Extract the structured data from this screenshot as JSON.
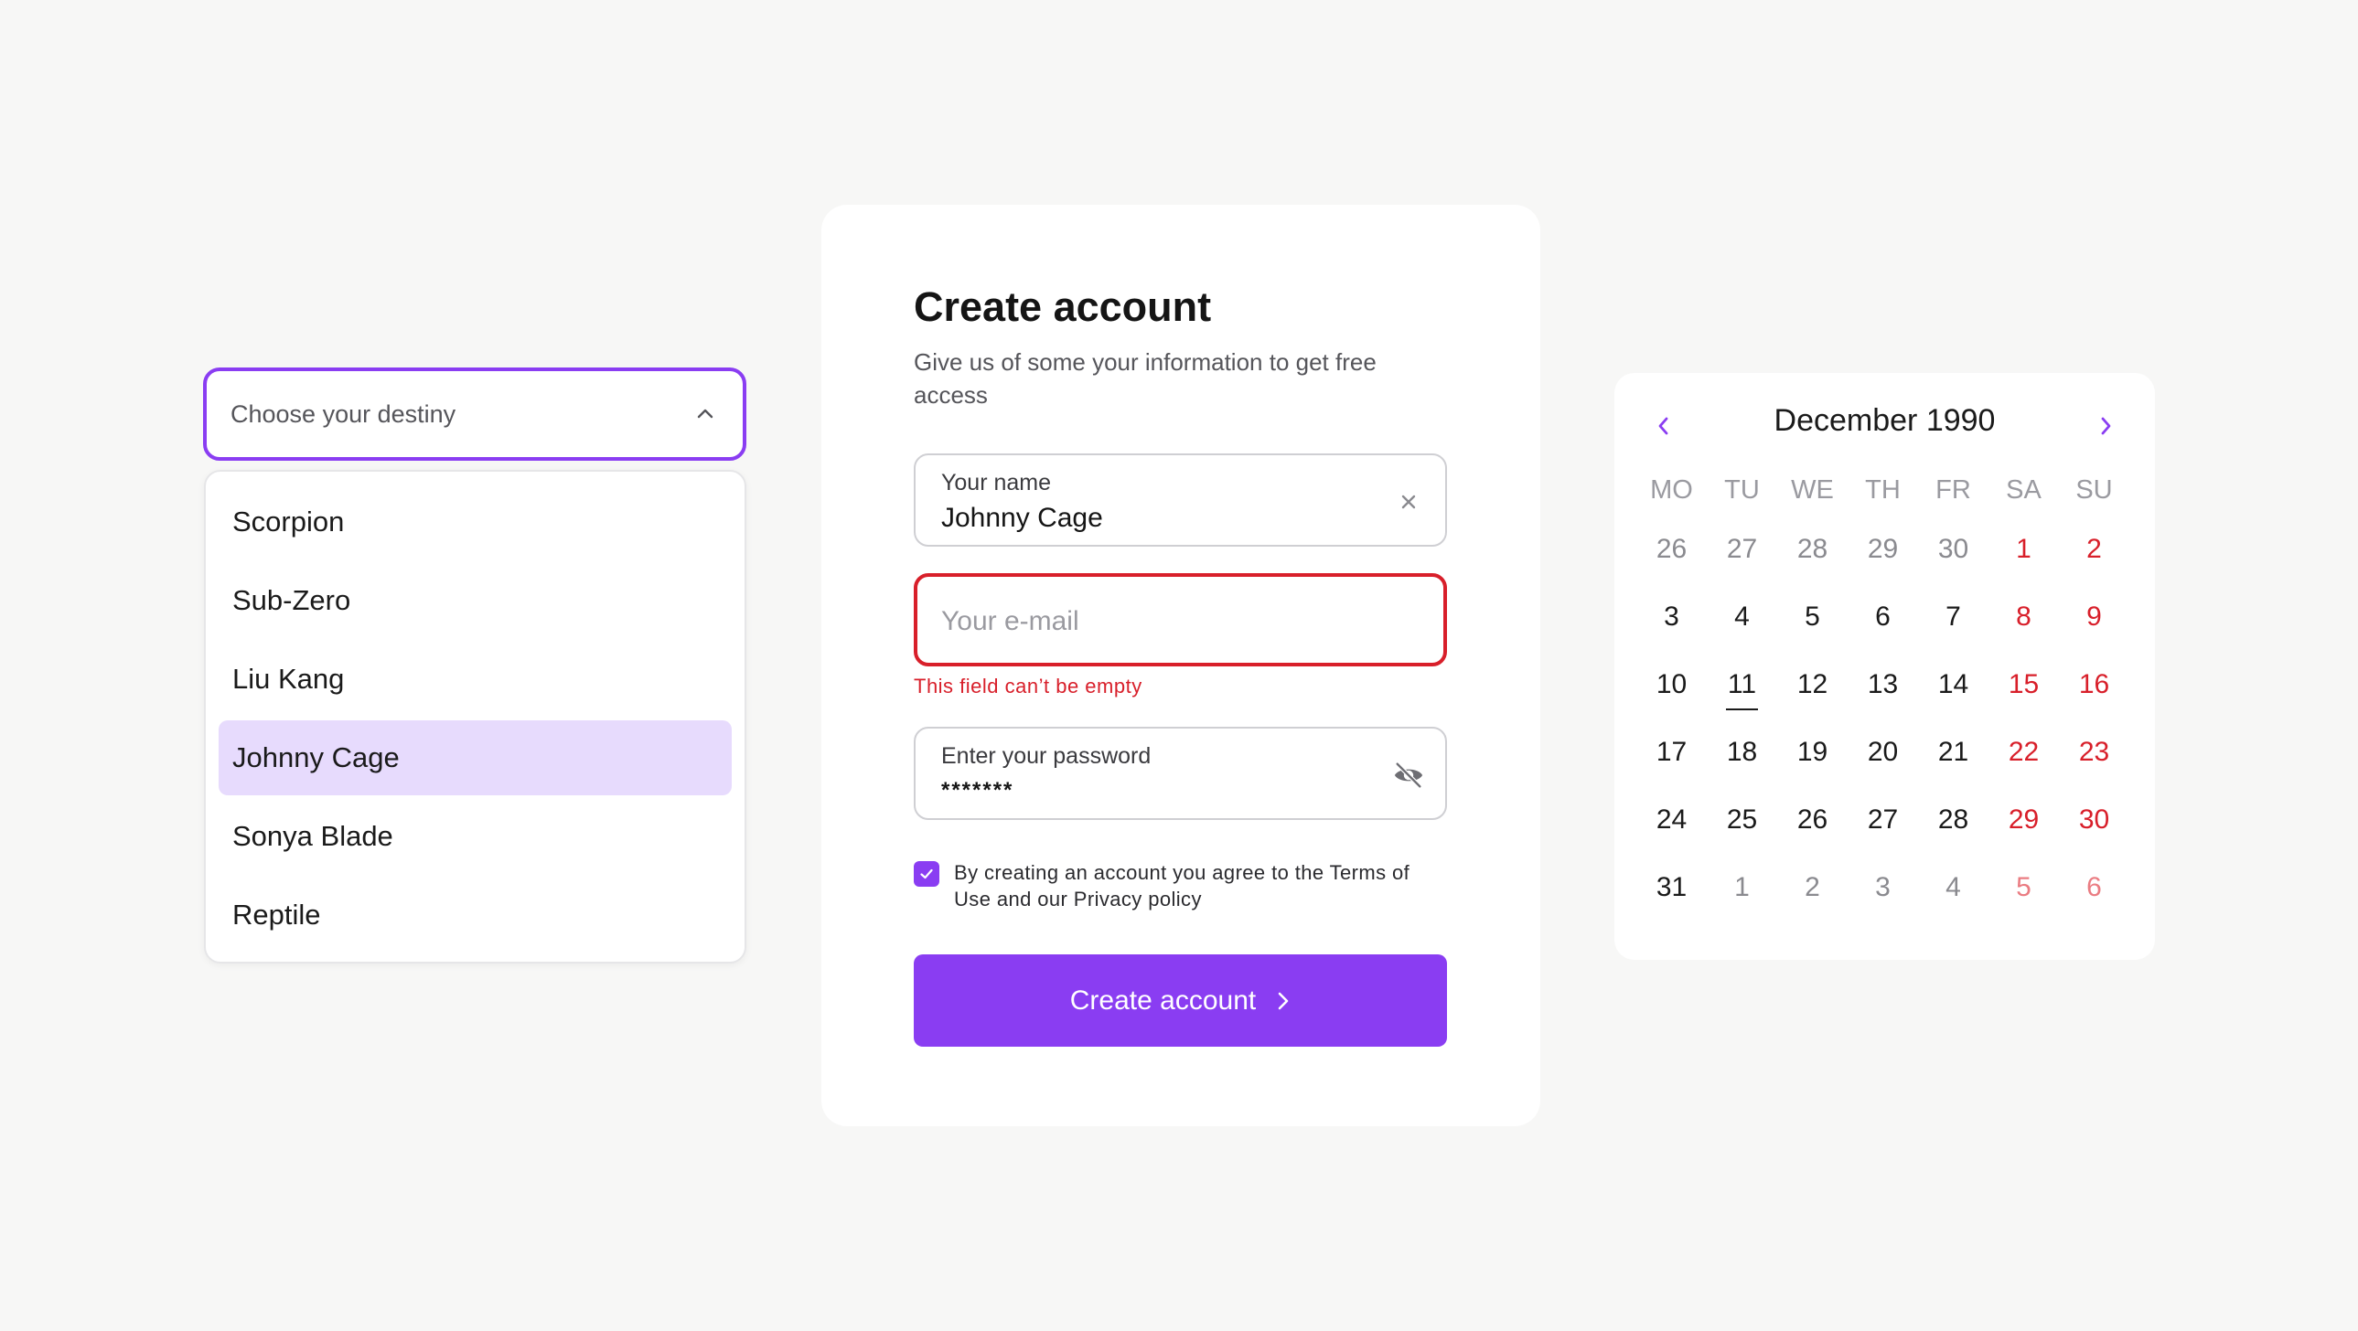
{
  "dropdown": {
    "placeholder": "Choose your destiny",
    "open": true,
    "selected": "Johnny Cage",
    "options": [
      "Scorpion",
      "Sub-Zero",
      "Liu Kang",
      "Johnny Cage",
      "Sonya Blade",
      "Reptile"
    ]
  },
  "form": {
    "title": "Create account",
    "subtitle": "Give us of some your information to get free access",
    "name_field": {
      "label": "Your name",
      "value": "Johnny Cage"
    },
    "email_field": {
      "placeholder": "Your e-mail",
      "error": "This field can’t be empty"
    },
    "password_field": {
      "label": "Enter your password",
      "value": "*******"
    },
    "agree": {
      "checked": true,
      "text": "By creating an account you agree to the Terms of Use and our Privacy policy"
    },
    "submit_label": "Create account"
  },
  "calendar": {
    "title": "December 1990",
    "weekdays": [
      "MO",
      "TU",
      "WE",
      "TH",
      "FR",
      "SA",
      "SU"
    ],
    "today": "11",
    "weeks": [
      [
        {
          "d": "26",
          "m": true
        },
        {
          "d": "27",
          "m": true
        },
        {
          "d": "28",
          "m": true
        },
        {
          "d": "29",
          "m": true
        },
        {
          "d": "30",
          "m": true
        },
        {
          "d": "1",
          "m": false
        },
        {
          "d": "2",
          "m": false
        }
      ],
      [
        {
          "d": "3",
          "m": false
        },
        {
          "d": "4",
          "m": false
        },
        {
          "d": "5",
          "m": false
        },
        {
          "d": "6",
          "m": false
        },
        {
          "d": "7",
          "m": false
        },
        {
          "d": "8",
          "m": false
        },
        {
          "d": "9",
          "m": false
        }
      ],
      [
        {
          "d": "10",
          "m": false
        },
        {
          "d": "11",
          "m": false
        },
        {
          "d": "12",
          "m": false
        },
        {
          "d": "13",
          "m": false
        },
        {
          "d": "14",
          "m": false
        },
        {
          "d": "15",
          "m": false
        },
        {
          "d": "16",
          "m": false
        }
      ],
      [
        {
          "d": "17",
          "m": false
        },
        {
          "d": "18",
          "m": false
        },
        {
          "d": "19",
          "m": false
        },
        {
          "d": "20",
          "m": false
        },
        {
          "d": "21",
          "m": false
        },
        {
          "d": "22",
          "m": false
        },
        {
          "d": "23",
          "m": false
        }
      ],
      [
        {
          "d": "24",
          "m": false
        },
        {
          "d": "25",
          "m": false
        },
        {
          "d": "26",
          "m": false
        },
        {
          "d": "27",
          "m": false
        },
        {
          "d": "28",
          "m": false
        },
        {
          "d": "29",
          "m": false
        },
        {
          "d": "30",
          "m": false
        }
      ],
      [
        {
          "d": "31",
          "m": false
        },
        {
          "d": "1",
          "m": true
        },
        {
          "d": "2",
          "m": true
        },
        {
          "d": "3",
          "m": true
        },
        {
          "d": "4",
          "m": true
        },
        {
          "d": "5",
          "m": true
        },
        {
          "d": "6",
          "m": true
        }
      ]
    ]
  },
  "colors": {
    "accent": "#8a3df2",
    "selected_bg": "#e7dbfd",
    "error": "#d81f2a",
    "background": "#f7f7f6"
  },
  "icons": {
    "dropdown_toggle": "chevron-up-icon",
    "clear_name": "close-icon",
    "password_visibility": "eye-off-icon",
    "checkbox": "check-icon",
    "submit_arrow": "chevron-right-icon",
    "calendar_prev": "chevron-left-icon",
    "calendar_next": "chevron-right-icon"
  }
}
